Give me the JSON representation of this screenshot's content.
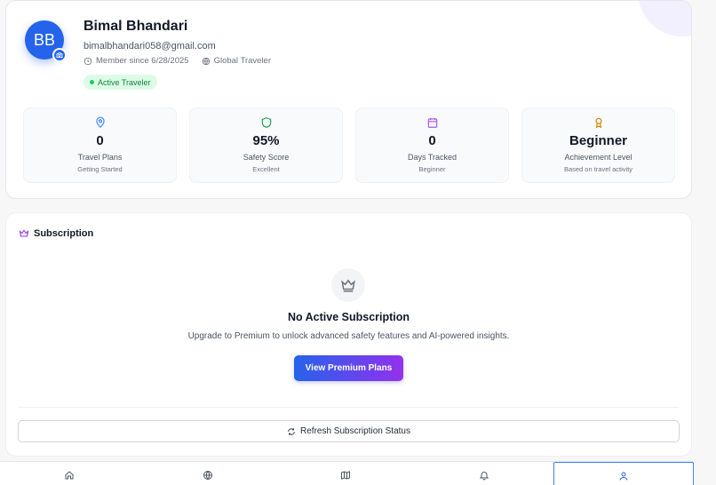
{
  "profile": {
    "initials": "BB",
    "name": "Bimal Bhandari",
    "email": "bimalbhandari058@gmail.com",
    "member_since": "Member since 6/28/2025",
    "traveler_type": "Global Traveler",
    "status_badge": "Active Traveler"
  },
  "stats": [
    {
      "icon": "map-pin-icon",
      "value": "0",
      "label": "Travel Plans",
      "sub": "Getting Started",
      "color": "#3b82f6"
    },
    {
      "icon": "shield-icon",
      "value": "95%",
      "label": "Safety Score",
      "sub": "Excellent",
      "color": "#16a34a"
    },
    {
      "icon": "calendar-icon",
      "value": "0",
      "label": "Days Tracked",
      "sub": "Beginner",
      "color": "#a855f7"
    },
    {
      "icon": "award-icon",
      "value": "Beginner",
      "label": "Achievement Level",
      "sub": "Based on travel activity",
      "color": "#ca8a04"
    }
  ],
  "subscription": {
    "heading": "Subscription",
    "empty_title": "No Active Subscription",
    "empty_desc": "Upgrade to Premium to unlock advanced safety features and AI-powered insights.",
    "cta_label": "View Premium Plans",
    "refresh_label": "Refresh Subscription Status"
  },
  "nav": {
    "items": [
      {
        "icon": "home-icon",
        "active": false
      },
      {
        "icon": "globe-icon",
        "active": false
      },
      {
        "icon": "map-icon",
        "active": false
      },
      {
        "icon": "bell-icon",
        "active": false
      },
      {
        "icon": "user-icon",
        "active": true
      }
    ]
  },
  "colors": {
    "primary": "#2563eb",
    "accent_purple": "#9333ea",
    "success": "#22c55e"
  }
}
